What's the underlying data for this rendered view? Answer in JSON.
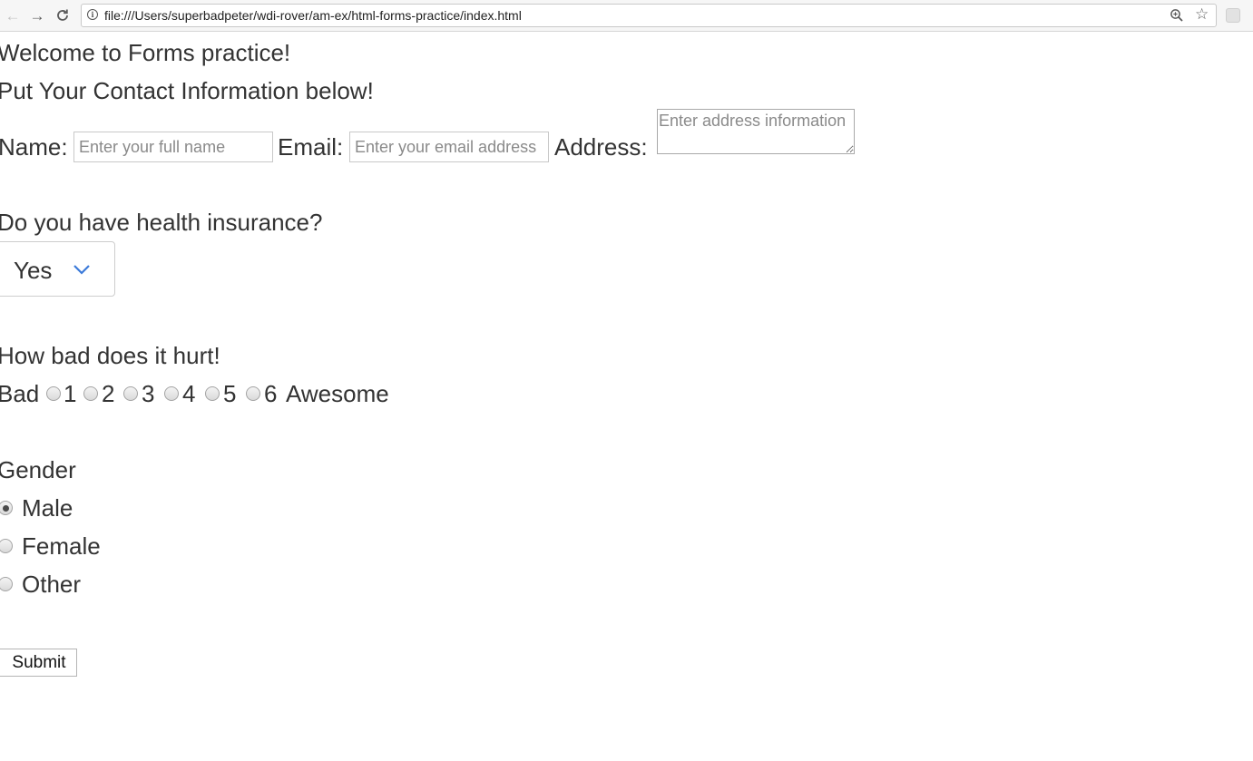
{
  "browser": {
    "url": "file:///Users/superbadpeter/wdi-rover/am-ex/html-forms-practice/index.html"
  },
  "page": {
    "heading": "Welcome to Forms practice!",
    "subheading": "Put Your Contact Information below!",
    "contact": {
      "name_label": "Name:",
      "name_placeholder": "Enter your full name",
      "email_label": "Email:",
      "email_placeholder": "Enter your email address",
      "address_label": "Address:",
      "address_placeholder": "Enter address information"
    },
    "insurance": {
      "question": "Do you have health insurance?",
      "selected": "Yes"
    },
    "pain": {
      "question": "How bad does it hurt!",
      "low_label": "Bad",
      "high_label": "Awesome",
      "options": [
        "1",
        "2",
        "3",
        "4",
        "5",
        "6"
      ]
    },
    "gender": {
      "label": "Gender",
      "options": [
        "Male",
        "Female",
        "Other"
      ],
      "selected": "Male"
    },
    "submit_label": "Submit"
  }
}
